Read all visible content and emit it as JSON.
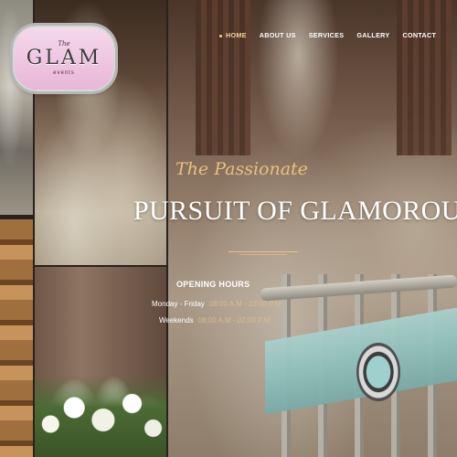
{
  "brand": {
    "the": "The",
    "name": "GLAM",
    "sub": "events"
  },
  "nav": {
    "items": [
      {
        "label": "HOME",
        "active": true
      },
      {
        "label": "ABOUT US",
        "active": false
      },
      {
        "label": "SERVICES",
        "active": false
      },
      {
        "label": "GALLERY",
        "active": false
      },
      {
        "label": "CONTACT",
        "active": false
      }
    ]
  },
  "hero": {
    "tagline": "The Passionate",
    "headline": "PURSUIT OF GLAMOROUS"
  },
  "hours": {
    "title": "OPENING HOURS",
    "rows": [
      {
        "days": "Monday - Friday",
        "time": "08:00 A.M - 23:00 P.M"
      },
      {
        "days": "Weekends",
        "time": "08:00 A.M - 02:00 P.M"
      }
    ]
  },
  "colors": {
    "accent_gold": "#e8c27a",
    "nav_active": "#f3d79a",
    "logo_pink": "#e9b6d8",
    "sash_teal": "#8fbfbb"
  }
}
